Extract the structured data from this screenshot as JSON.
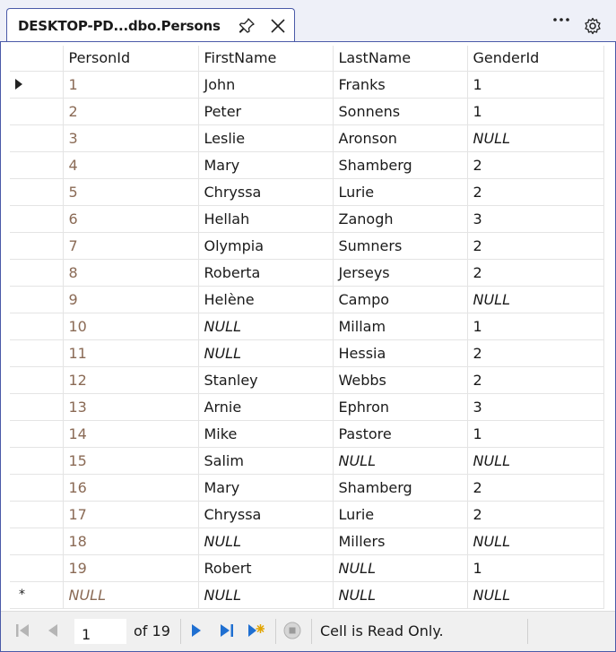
{
  "tab": {
    "title": "DESKTOP-PD...dbo.Persons"
  },
  "toolbar": {
    "more_icon": "more-icon",
    "settings_icon": "gear-icon"
  },
  "grid": {
    "columns": [
      "PersonId",
      "FirstName",
      "LastName",
      "GenderId"
    ],
    "rows": [
      {
        "marker": "current",
        "cells": [
          "1",
          "John",
          "Franks",
          "1"
        ]
      },
      {
        "marker": "",
        "cells": [
          "2",
          "Peter",
          "Sonnens",
          "1"
        ]
      },
      {
        "marker": "",
        "cells": [
          "3",
          "Leslie",
          "Aronson",
          "NULL"
        ]
      },
      {
        "marker": "",
        "cells": [
          "4",
          "Mary",
          "Shamberg",
          "2"
        ]
      },
      {
        "marker": "",
        "cells": [
          "5",
          "Chryssa",
          "Lurie",
          "2"
        ]
      },
      {
        "marker": "",
        "cells": [
          "6",
          "Hellah",
          "Zanogh",
          "3"
        ]
      },
      {
        "marker": "",
        "cells": [
          "7",
          "Olympia",
          "Sumners",
          "2"
        ]
      },
      {
        "marker": "",
        "cells": [
          "8",
          "Roberta",
          "Jerseys",
          "2"
        ]
      },
      {
        "marker": "",
        "cells": [
          "9",
          "Helène",
          "Campo",
          "NULL"
        ]
      },
      {
        "marker": "",
        "cells": [
          "10",
          "NULL",
          "Millam",
          "1"
        ]
      },
      {
        "marker": "",
        "cells": [
          "11",
          "NULL",
          "Hessia",
          "2"
        ]
      },
      {
        "marker": "",
        "cells": [
          "12",
          "Stanley",
          "Webbs",
          "2"
        ]
      },
      {
        "marker": "",
        "cells": [
          "13",
          "Arnie",
          "Ephron",
          "3"
        ]
      },
      {
        "marker": "",
        "cells": [
          "14",
          "Mike",
          "Pastore",
          "1"
        ]
      },
      {
        "marker": "",
        "cells": [
          "15",
          "Salim",
          "NULL",
          "NULL"
        ]
      },
      {
        "marker": "",
        "cells": [
          "16",
          "Mary",
          "Shamberg",
          "2"
        ]
      },
      {
        "marker": "",
        "cells": [
          "17",
          "Chryssa",
          "Lurie",
          "2"
        ]
      },
      {
        "marker": "",
        "cells": [
          "18",
          "NULL",
          "Millers",
          "NULL"
        ]
      },
      {
        "marker": "",
        "cells": [
          "19",
          "Robert",
          "NULL",
          "1"
        ]
      },
      {
        "marker": "new",
        "cells": [
          "NULL",
          "NULL",
          "NULL",
          "NULL"
        ]
      }
    ]
  },
  "navigation": {
    "position_value": "1",
    "of_label": "of 19",
    "status_text": "Cell is Read Only.",
    "colors": {
      "accent": "#4a5aa8",
      "id_text": "#8a6a55",
      "nav_blue": "#1f6fd1"
    }
  }
}
